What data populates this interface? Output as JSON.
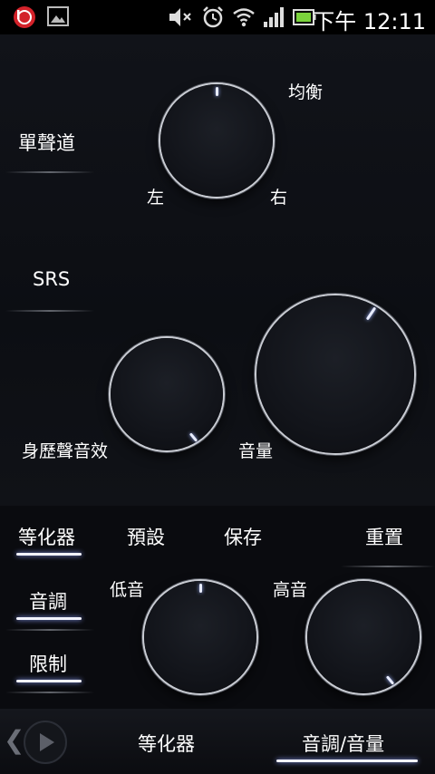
{
  "status_bar": {
    "time": "下午 12:11",
    "icons": [
      "beats-icon",
      "image-icon",
      "mute-icon",
      "alarm-icon",
      "wifi-icon",
      "signal-icon",
      "battery-icon"
    ]
  },
  "mono": {
    "label": "單聲道"
  },
  "balance": {
    "title": "均衡",
    "left_label": "左",
    "right_label": "右"
  },
  "srs": {
    "label": "SRS"
  },
  "surround": {
    "label": "身歷聲音效"
  },
  "volume": {
    "label": "音量"
  },
  "menu": {
    "equalizer": "等化器",
    "presets": "預設",
    "save": "保存",
    "reset": "重置",
    "tone": "音調",
    "limit": "限制"
  },
  "tone": {
    "bass_label": "低音",
    "treble_label": "高音"
  },
  "bottom_tabs": {
    "equalizer": "等化器",
    "tone_volume": "音調/音量"
  },
  "colors": {
    "accent": "#9fb4ff",
    "background": "#0b0d12"
  }
}
